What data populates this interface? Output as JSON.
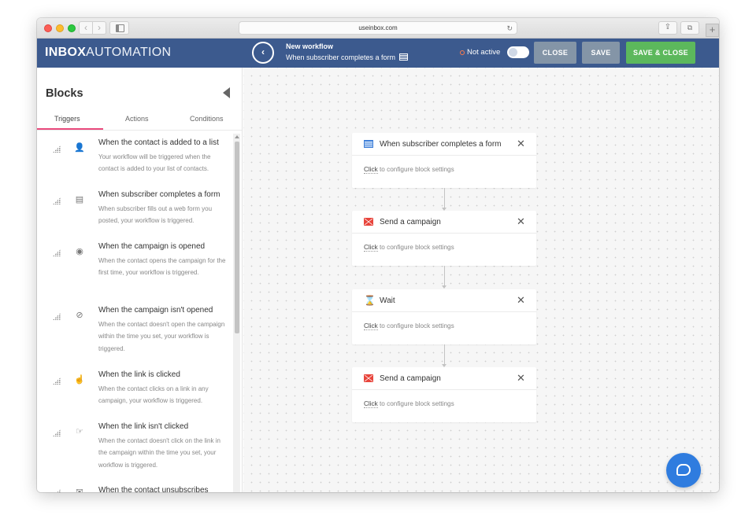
{
  "browser": {
    "url": "useinbox.com",
    "reload_glyph": "↻",
    "back_glyph": "‹",
    "forward_glyph": "›",
    "share_glyph": "⇪",
    "tabs_glyph": "⧉",
    "newtab_glyph": "+"
  },
  "header": {
    "logo_bold": "INBOX",
    "logo_thin": "AUTOMATION",
    "back_glyph": "‹",
    "workflow_title": "New workflow",
    "workflow_subtitle": "When subscriber completes a form",
    "status_text": "Not active",
    "status_color": "#ff7b4a",
    "close_label": "CLOSE",
    "save_label": "SAVE",
    "save_close_label": "SAVE & CLOSE",
    "brand_color": "#3c5a8e",
    "save_close_color": "#5cb85c"
  },
  "sidebar": {
    "title": "Blocks",
    "tabs": [
      {
        "label": "Triggers",
        "active": true
      },
      {
        "label": "Actions",
        "active": false
      },
      {
        "label": "Conditions",
        "active": false
      }
    ],
    "active_tab_color": "#e94a7c",
    "triggers": [
      {
        "icon": "user-add-icon",
        "glyph": "👤",
        "title": "When the contact is added to a list",
        "desc": "Your workflow will be triggered when the contact is added to your list of contacts."
      },
      {
        "icon": "form-icon",
        "glyph": "▤",
        "title": "When subscriber completes a form",
        "desc": "When subscriber fills out a web form you posted, your workflow is triggered."
      },
      {
        "icon": "eye-icon",
        "glyph": "◉",
        "title": "When the campaign is opened",
        "desc": "When the contact opens the campaign for the first time, your workflow is triggered."
      },
      {
        "icon": "eye-off-icon",
        "glyph": "⊘",
        "title": "When the campaign isn't opened",
        "desc": "When the contact doesn't open the campaign within the time you set, your workflow is triggered."
      },
      {
        "icon": "pointer-icon",
        "glyph": "☝",
        "title": "When the link is clicked",
        "desc": "When the contact clicks on a link in any campaign, your workflow is triggered."
      },
      {
        "icon": "pointer-off-icon",
        "glyph": "☞",
        "title": "When the link isn't clicked",
        "desc": "When the contact doesn't click on the link in the campaign within the time you set, your workflow is triggered."
      },
      {
        "icon": "unsubscribe-icon",
        "glyph": "✉",
        "title": "When the contact unsubscribes",
        "desc": ""
      }
    ]
  },
  "canvas": {
    "blocks": [
      {
        "icon": "form-icon",
        "title": "When subscriber completes a form",
        "click_label": "Click",
        "hint": " to configure block settings",
        "close_glyph": "✕"
      },
      {
        "icon": "mail-icon",
        "title": "Send a campaign",
        "click_label": "Click",
        "hint": " to configure block settings",
        "close_glyph": "✕"
      },
      {
        "icon": "hourglass-icon",
        "title": "Wait",
        "click_label": "Click",
        "hint": " to configure block settings",
        "close_glyph": "✕",
        "glyph": "⌛"
      },
      {
        "icon": "mail-icon",
        "title": "Send a campaign",
        "click_label": "Click",
        "hint": " to configure block settings",
        "close_glyph": "✕"
      }
    ],
    "icon_blue": "#3e7fd8",
    "icon_red": "#e8453c",
    "chat_color": "#2f7cdf"
  }
}
